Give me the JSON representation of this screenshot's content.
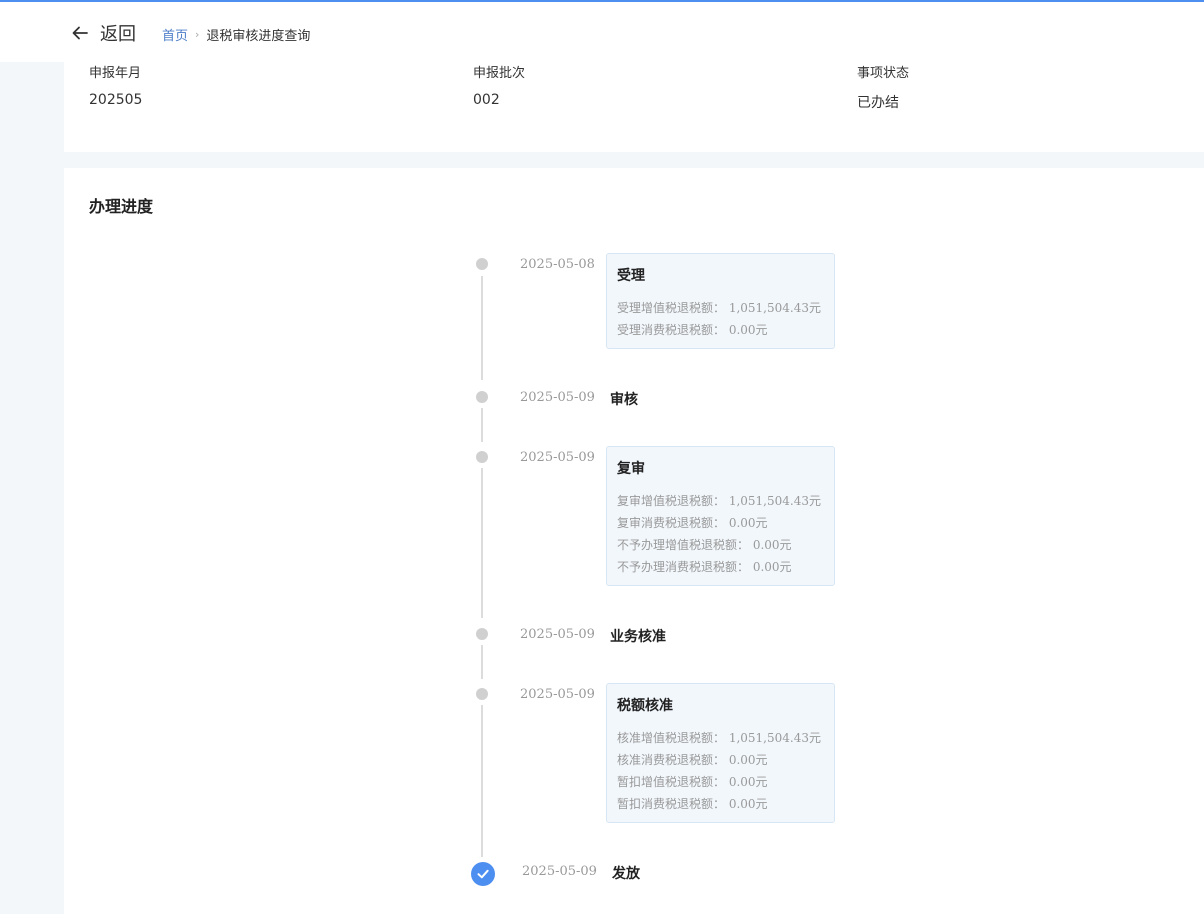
{
  "header": {
    "back_label": "返回",
    "breadcrumb": {
      "home": "首页",
      "current": "退税审核进度查询"
    }
  },
  "info": {
    "fields": [
      {
        "label": "申报年月",
        "value": "202505"
      },
      {
        "label": "申报批次",
        "value": "002"
      },
      {
        "label": "事项状态",
        "value": "已办结"
      }
    ]
  },
  "progress": {
    "title": "办理进度",
    "steps": [
      {
        "date": "2025-05-08",
        "title": "受理",
        "lines": [
          "受理增值税退税额： 1,051,504.43元",
          "受理消费税退税额： 0.00元"
        ]
      },
      {
        "date": "2025-05-09",
        "title": "审核",
        "lines": []
      },
      {
        "date": "2025-05-09",
        "title": "复审",
        "lines": [
          "复审增值税退税额： 1,051,504.43元",
          "复审消费税退税额： 0.00元",
          "不予办理增值税退税额： 0.00元",
          "不予办理消费税退税额： 0.00元"
        ]
      },
      {
        "date": "2025-05-09",
        "title": "业务核准",
        "lines": []
      },
      {
        "date": "2025-05-09",
        "title": "税额核准",
        "lines": [
          "核准增值税退税额： 1,051,504.43元",
          "核准消费税退税额： 0.00元",
          "暂扣增值税退税额： 0.00元",
          "暂扣消费税退税额： 0.00元"
        ]
      },
      {
        "date": "2025-05-09",
        "title": "发放",
        "lines": [],
        "completed": true
      }
    ]
  },
  "colors": {
    "accent": "#4d8ff0",
    "link": "#4d7ec8",
    "box_bg": "#f2f7fc"
  }
}
